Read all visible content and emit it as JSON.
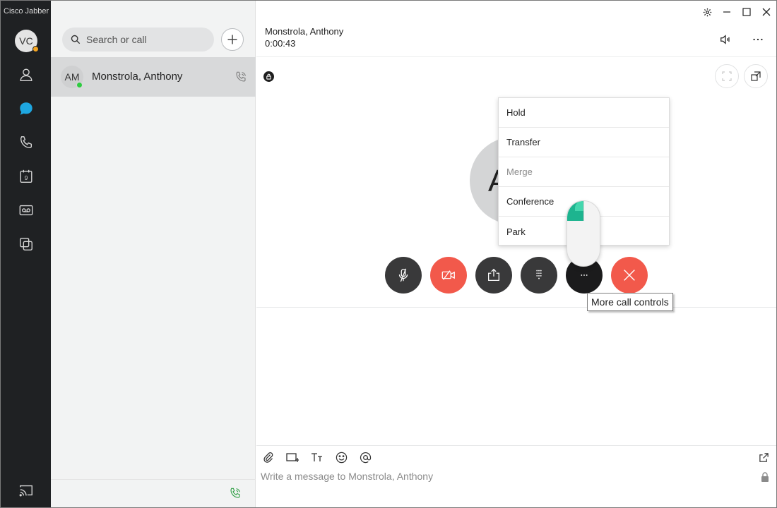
{
  "app": {
    "title": "Cisco Jabber"
  },
  "rail": {
    "user_initials": "VC",
    "presence_color": "#f5a623",
    "items": [
      {
        "name": "contacts",
        "icon": "person-icon"
      },
      {
        "name": "chats",
        "icon": "chat-bubble-icon",
        "active": true
      },
      {
        "name": "calls",
        "icon": "phone-icon"
      },
      {
        "name": "meetings",
        "icon": "calendar-icon",
        "badge": "9"
      },
      {
        "name": "voicemail",
        "icon": "voicemail-icon"
      },
      {
        "name": "custom-tabs",
        "icon": "overlap-squares-icon"
      },
      {
        "name": "screen-cast",
        "icon": "cast-icon"
      }
    ]
  },
  "panel": {
    "search_placeholder": "Search or call",
    "contacts": [
      {
        "initials": "AM",
        "name": "Monstrola, Anthony",
        "presence": "available",
        "presence_color": "#2ecc40"
      }
    ]
  },
  "call": {
    "contact_name": "Monstrola, Anthony",
    "duration": "0:00:43",
    "avatar_letter": "A",
    "controls": [
      {
        "name": "mute",
        "icon": "mic-muted-icon",
        "style": "dark"
      },
      {
        "name": "video",
        "icon": "video-off-icon",
        "style": "red"
      },
      {
        "name": "share",
        "icon": "share-icon",
        "style": "dark"
      },
      {
        "name": "keypad",
        "icon": "keypad-icon",
        "style": "dark"
      },
      {
        "name": "more",
        "icon": "more-dots-icon",
        "style": "dark"
      },
      {
        "name": "end-call",
        "icon": "close-icon",
        "style": "red"
      }
    ],
    "menu": [
      {
        "label": "Hold",
        "enabled": true
      },
      {
        "label": "Transfer",
        "enabled": true
      },
      {
        "label": "Merge",
        "enabled": false
      },
      {
        "label": "Conference",
        "enabled": true
      },
      {
        "label": "Park",
        "enabled": true
      }
    ],
    "tooltip": "More call controls"
  },
  "composer": {
    "placeholder": "Write a message to Monstrola, Anthony"
  },
  "colors": {
    "rail_bg": "#1f2123",
    "accent_blue": "#1ea7e1",
    "end_call_red": "#f2594b",
    "dark_button": "#39393a",
    "call_green": "#2f9e44"
  }
}
